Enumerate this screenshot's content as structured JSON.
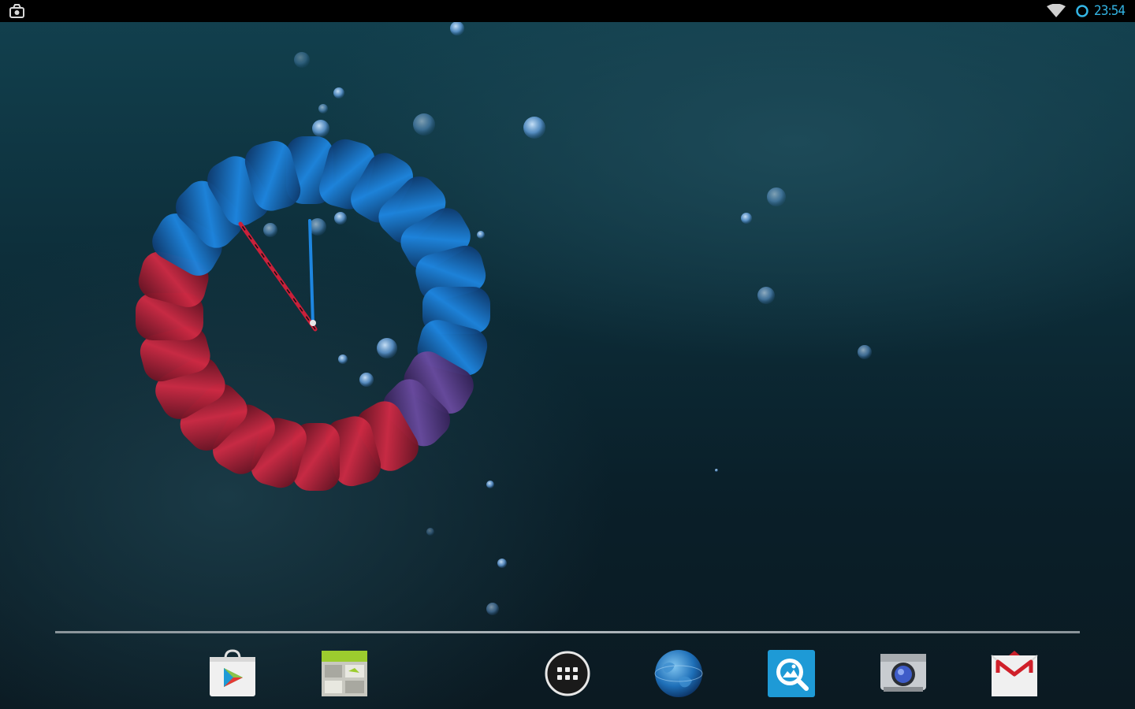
{
  "status_bar": {
    "time": "23:54",
    "icons": [
      "notification-icon",
      "wifi-icon",
      "sync-icon"
    ],
    "accent_color": "#33b5e5"
  },
  "wallpaper": {
    "widget": "analog-clock",
    "colors": {
      "blue": "#1e7fd6",
      "red": "#c9203a",
      "background": "#0d2f3b"
    }
  },
  "dock": {
    "apps": [
      {
        "name": "Play Store",
        "icon": "play-store-icon"
      },
      {
        "name": "Gallery",
        "icon": "gallery-icon"
      },
      {
        "name": "Apps",
        "icon": "app-drawer-icon"
      },
      {
        "name": "Browser",
        "icon": "browser-globe-icon"
      },
      {
        "name": "Gallery",
        "icon": "picture-icon"
      },
      {
        "name": "Camera",
        "icon": "camera-icon"
      },
      {
        "name": "Gmail",
        "icon": "gmail-icon"
      }
    ]
  }
}
